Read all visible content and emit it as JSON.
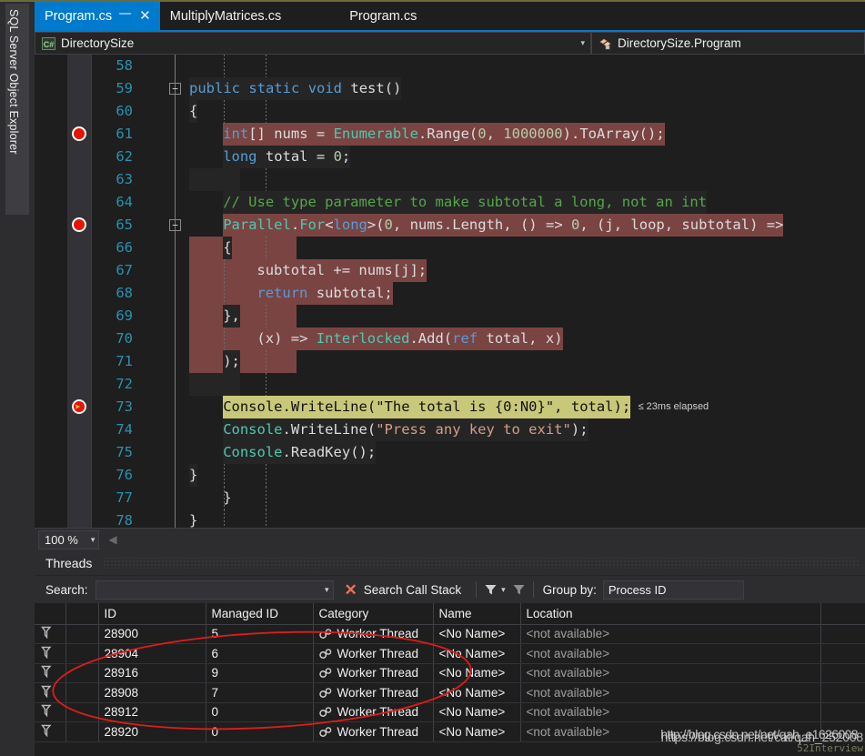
{
  "window": {
    "left_dock_label": "SQL Server Object Explorer"
  },
  "tabs": [
    {
      "label": "Program.cs",
      "active": true,
      "pin_icon": "pin-icon",
      "close_icon": "close-icon"
    },
    {
      "label": "MultiplyMatrices.cs",
      "active": false
    },
    {
      "label": "Program.cs",
      "active": false
    }
  ],
  "navbar": {
    "left": {
      "icon": "csharp-file-icon",
      "badge": "C#",
      "value": "DirectorySize",
      "caret": "▾"
    },
    "right": {
      "icon": "method-icon",
      "value": "DirectorySize.Program"
    }
  },
  "editor": {
    "zoom_level": "100 %",
    "zoom_caret": "▾",
    "hscroll_left_icon": "scroll-left-arrow",
    "perf_tip": "≤ 23ms elapsed",
    "fold_collapse_glyph": "−",
    "lines": [
      {
        "num": "58",
        "text": "",
        "highlight": "none"
      },
      {
        "num": "59",
        "text": "public static void test()",
        "highlight": "dark",
        "fold": true
      },
      {
        "num": "60",
        "text": "{",
        "highlight": "dark"
      },
      {
        "num": "61",
        "text": "    int[] nums = Enumerable.Range(0, 1000000).ToArray();",
        "highlight": "sel",
        "breakpoint": "red"
      },
      {
        "num": "62",
        "text": "    long total = 0;",
        "highlight": "dark"
      },
      {
        "num": "63",
        "text": "",
        "highlight": "dark"
      },
      {
        "num": "64",
        "text": "    // Use type parameter to make subtotal a long, not an int",
        "highlight": "dark"
      },
      {
        "num": "65",
        "text": "    Parallel.For<long>(0, nums.Length, () => 0, (j, loop, subtotal) =>",
        "highlight": "sel",
        "breakpoint": "red",
        "fold": true
      },
      {
        "num": "66",
        "text": "    {",
        "highlight": "dark"
      },
      {
        "num": "67",
        "text": "        subtotal += nums[j];",
        "highlight": "sel"
      },
      {
        "num": "68",
        "text": "        return subtotal;",
        "highlight": "sel"
      },
      {
        "num": "69",
        "text": "    },",
        "highlight": "dark"
      },
      {
        "num": "70",
        "text": "        (x) => Interlocked.Add(ref total, x)",
        "highlight": "sel"
      },
      {
        "num": "71",
        "text": "    );",
        "highlight": "dark"
      },
      {
        "num": "72",
        "text": "",
        "highlight": "dark"
      },
      {
        "num": "73",
        "text": "    Console.WriteLine(\"The total is {0:N0}\", total);",
        "highlight": "current",
        "breakpoint": "current"
      },
      {
        "num": "74",
        "text": "    Console.WriteLine(\"Press any key to exit\");",
        "highlight": "dark"
      },
      {
        "num": "75",
        "text": "    Console.ReadKey();",
        "highlight": "dark"
      },
      {
        "num": "76",
        "text": "}",
        "highlight": "dark"
      },
      {
        "num": "77",
        "text": "    }",
        "highlight": "none"
      },
      {
        "num": "78",
        "text": "}",
        "highlight": "none"
      }
    ]
  },
  "threads_panel": {
    "title": "Threads",
    "search_label": "Search:",
    "search_value": "",
    "search_placeholder": "",
    "search_caret": "▾",
    "clear_icon": "close-x-icon",
    "search_call_stack_label": "Search Call Stack",
    "filter_icon": "funnel-icon",
    "filter_caret": "▾",
    "filter_icon_2": "funnel-icon",
    "group_by_label": "Group by:",
    "group_by_value": "Process ID",
    "columns": [
      "",
      "",
      "ID",
      "Managed ID",
      "Category",
      "Name",
      "Location",
      ""
    ],
    "rows": [
      {
        "flag": "flag-icon",
        "suspend": "",
        "id": "28900",
        "managed_id": "5",
        "category": "Worker Thread",
        "category_icon": "gears-icon",
        "name": "<No Name>",
        "location": "<not available>"
      },
      {
        "flag": "flag-icon",
        "suspend": "",
        "id": "28904",
        "managed_id": "6",
        "category": "Worker Thread",
        "category_icon": "gears-icon",
        "name": "<No Name>",
        "location": "<not available>"
      },
      {
        "flag": "flag-icon",
        "suspend": "",
        "id": "28916",
        "managed_id": "9",
        "category": "Worker Thread",
        "category_icon": "gears-icon",
        "name": "<No Name>",
        "location": "<not available>"
      },
      {
        "flag": "flag-icon",
        "suspend": "",
        "id": "28908",
        "managed_id": "7",
        "category": "Worker Thread",
        "category_icon": "gears-icon",
        "name": "<No Name>",
        "location": "<not available>"
      },
      {
        "flag": "flag-icon",
        "suspend": "",
        "id": "28912",
        "managed_id": "0",
        "category": "Worker Thread",
        "category_icon": "gears-icon",
        "name": "<No Name>",
        "location": "<not available>"
      },
      {
        "flag": "flag-icon",
        "suspend": "",
        "id": "28920",
        "managed_id": "0",
        "category": "Worker Thread",
        "category_icon": "gears-icon",
        "name": "<No Name>",
        "location": "<not available>"
      }
    ]
  },
  "annotation": {
    "shape": "hand-drawn-ellipse",
    "color": "#e01b1b"
  },
  "watermark": {
    "line1": "https://blog.csdn.net/cat/qah_252008",
    "line2": "http://blog.csdn.net/net/qah_e1626008",
    "line3": "52Interview"
  },
  "colors": {
    "accent": "#007acc",
    "breakpoint": "#e51400",
    "current_line": "#c9c87a",
    "selection": "#7a4443",
    "editor_bg": "#1e1e1e",
    "panel_bg": "#252526",
    "toolbar_bg": "#2d2d30"
  }
}
